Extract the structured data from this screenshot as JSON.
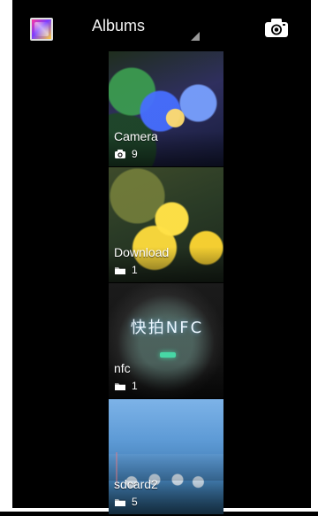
{
  "topbar": {
    "title": "Albums",
    "app_icon": "gallery-icon",
    "camera_icon": "camera-icon"
  },
  "albums": [
    {
      "name": "Camera",
      "count": "9",
      "meta_icon": "camera-icon"
    },
    {
      "name": "Download",
      "count": "1",
      "meta_icon": "folder-icon"
    },
    {
      "name": "nfc",
      "count": "1",
      "meta_icon": "folder-icon",
      "thumb_text": "快拍NFC"
    },
    {
      "name": "sdcard2",
      "count": "5",
      "meta_icon": "folder-icon"
    }
  ]
}
